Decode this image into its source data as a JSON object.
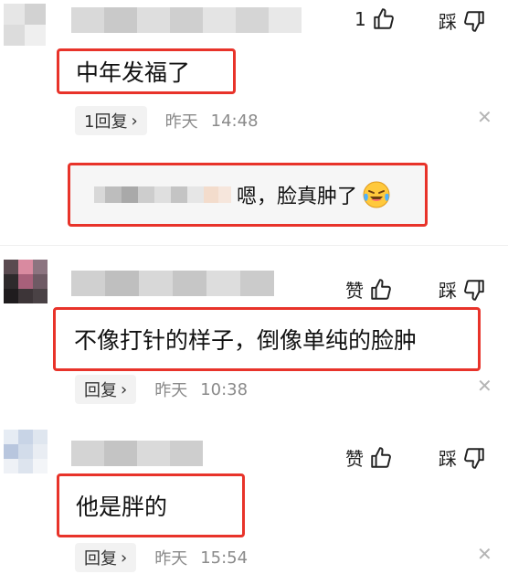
{
  "comments": [
    {
      "like_label": "1",
      "dislike_label": "踩",
      "text": "中年发福了",
      "reply_label": "1回复",
      "date": "昨天",
      "time": "14:48",
      "sub_reply": {
        "text": "嗯，脸真肿了"
      }
    },
    {
      "like_label": "赞",
      "dislike_label": "踩",
      "text": "不像打针的样子，倒像单纯的脸肿",
      "reply_label": "回复",
      "date": "昨天",
      "time": "10:38"
    },
    {
      "like_label": "赞",
      "dislike_label": "踩",
      "text": "他是胖的",
      "reply_label": "回复",
      "date": "昨天",
      "time": "15:54"
    }
  ],
  "icons": {
    "like": "thumbs-up-icon",
    "dislike": "thumbs-down-icon",
    "close": "close-icon",
    "chevron": "chevron-right-icon",
    "emoji": "crying-laughing-emoji-icon"
  },
  "colors": {
    "highlight": "#e8332a",
    "meta": "#8a8a8a",
    "reply_bg": "#f2f2f2"
  }
}
